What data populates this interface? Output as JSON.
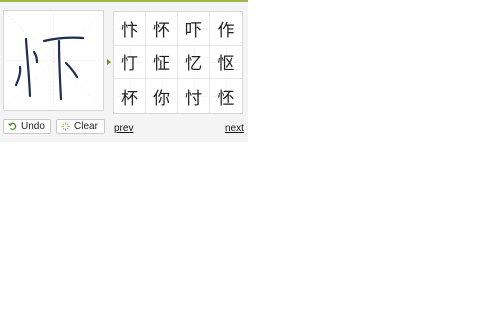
{
  "colors": {
    "accent_line": "#9cb64a",
    "stroke_ink": "#1f2f4f",
    "panel_bg": "#f4f4f4"
  },
  "candidates": [
    [
      "忭",
      "怀",
      "吓",
      "作"
    ],
    [
      "忊",
      "怔",
      "忆",
      "怄"
    ],
    [
      "杯",
      "你",
      "忖",
      "怌"
    ]
  ],
  "buttons": {
    "undo": {
      "label": "Undo",
      "icon": "undo-icon"
    },
    "clear": {
      "label": "Clear",
      "icon": "clear-icon"
    }
  },
  "pager": {
    "prev_label": "prev",
    "next_label": "next"
  }
}
